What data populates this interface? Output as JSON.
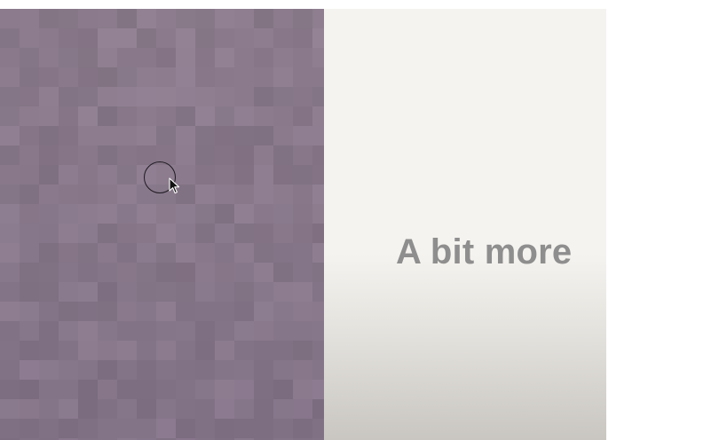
{
  "caption": {
    "text": "A bit more"
  },
  "colors": {
    "page_background": "#ffffff",
    "stage_background": "#f5f3ef",
    "stage_shadow": "#c9c6c1",
    "canvas_base": "#8b7b8c",
    "caption_text": "#8e8e8e",
    "cursor_outline": "#1e1a20"
  },
  "icons": {
    "cursor_ring": "circle-outline-icon",
    "pointer": "mouse-pointer-icon"
  }
}
